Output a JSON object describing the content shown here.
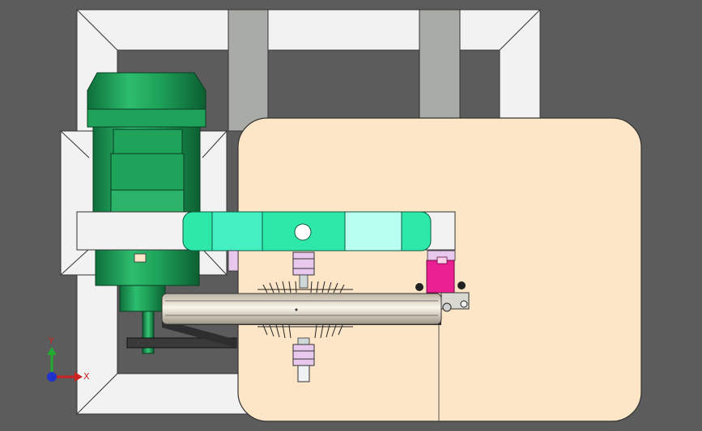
{
  "viewport": {
    "background": "#5c5c5c"
  },
  "colors": {
    "frame": "#f2f2f2",
    "frame_shadow": "#bdbdbd",
    "rail": "#a9aba7",
    "plate": "#fde6c8",
    "motor": "#1fa35a",
    "motor_dark": "#137a42",
    "arm": "#2ee8a9",
    "arm_light": "#b8fff2",
    "bearing": "#e8c8ec",
    "sensor": "#ea1f92",
    "pulley": "#e9e1cf",
    "belt": "#3a3a3a"
  },
  "triad": {
    "y_label": "Y",
    "x_label": "X",
    "y_color": "#22aa33",
    "x_color": "#cc2222",
    "z_color": "#2233cc"
  }
}
